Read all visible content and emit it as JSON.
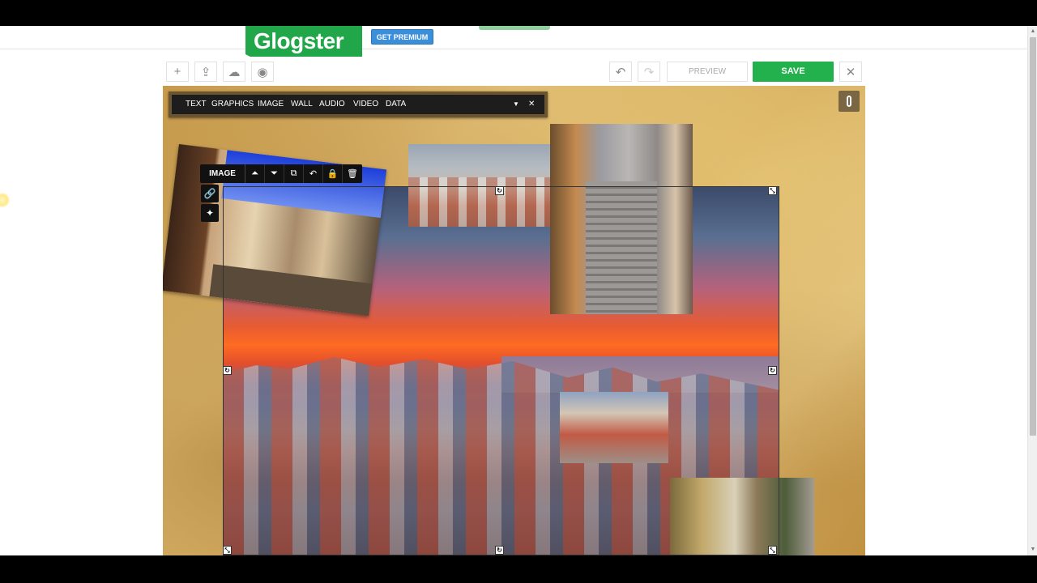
{
  "header": {
    "logo_text": "Glogster",
    "premium_label": "GET PREMIUM"
  },
  "toolbar": {
    "add_icon": "+",
    "share_icon": "⇪",
    "upload_icon": "☁",
    "camera_icon": "◉",
    "undo_icon": "↶",
    "redo_icon": "↷",
    "preview_label": "PREVIEW",
    "save_label": "SAVE",
    "close_icon": "✕"
  },
  "menu": {
    "items": [
      "TEXT",
      "GRAPHICS",
      "IMAGE",
      "WALL",
      "AUDIO",
      "VIDEO",
      "DATA"
    ],
    "dropdown_icon": "▼",
    "close_icon": "✕"
  },
  "image_toolbar": {
    "label": "IMAGE",
    "move_up_icon": "⏶",
    "move_down_icon": "⏷",
    "copy_icon": "⧉",
    "undo_icon": "↶",
    "lock_icon": "🔒",
    "delete_icon": "🗑",
    "link_icon": "🔗",
    "magic_icon": "✦"
  },
  "handles": {
    "resize": "⤡",
    "rotate": "↻"
  },
  "colors": {
    "brand": "#22a64a",
    "save": "#22b14c",
    "premium": "#3b8fd9"
  }
}
